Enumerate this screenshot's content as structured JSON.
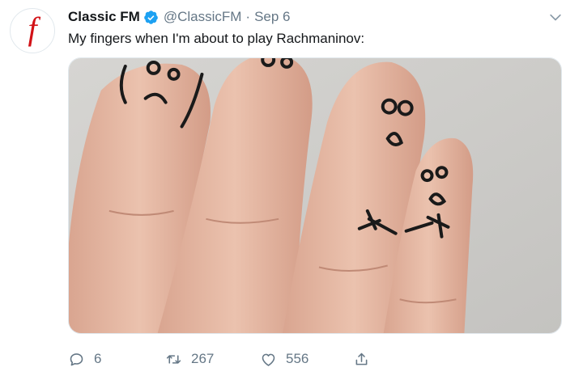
{
  "tweet": {
    "display_name": "Classic FM",
    "handle": "@ClassicFM",
    "separator": "·",
    "timestamp": "Sep 6",
    "text": "My fingers when I'm about to play Rachmaninov:",
    "verified": true,
    "avatar_glyph": "f"
  },
  "actions": {
    "replies": "6",
    "retweets": "267",
    "likes": "556"
  },
  "colors": {
    "avatar_red": "#d21217",
    "verified_blue": "#1da1f2",
    "muted_text": "#657786"
  },
  "icons": {
    "menu": "chevron-down-icon",
    "verified": "verified-badge-icon",
    "reply": "reply-icon",
    "retweet": "retweet-icon",
    "like": "heart-icon",
    "share": "share-icon"
  }
}
